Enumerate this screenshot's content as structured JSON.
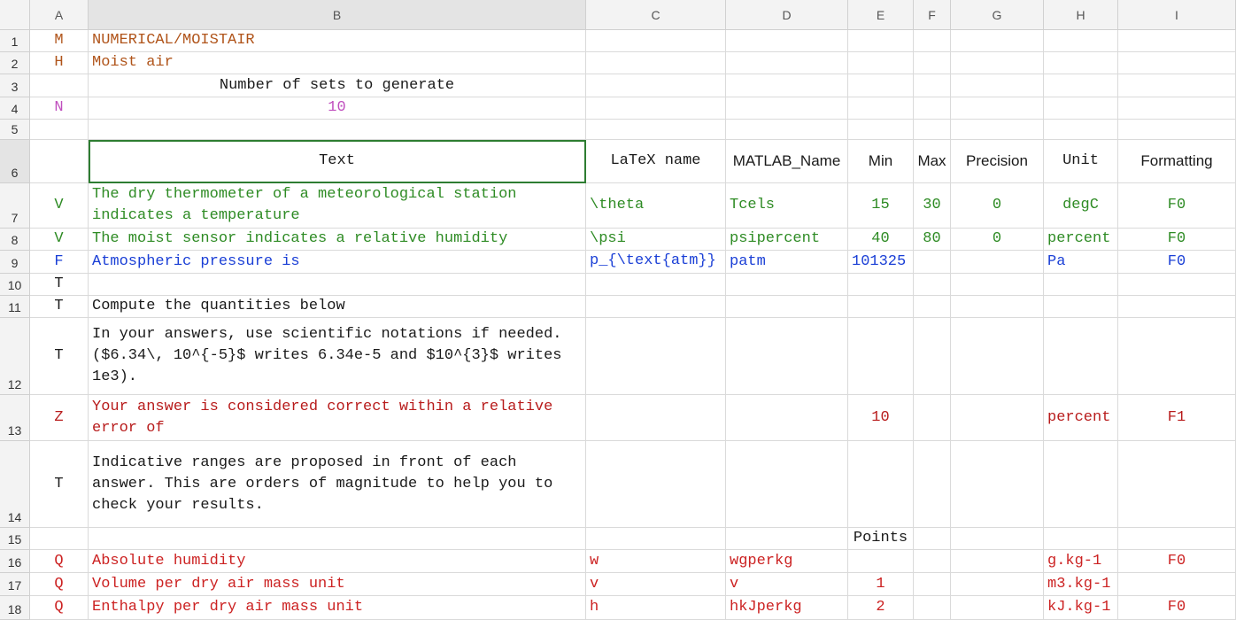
{
  "columns": [
    "A",
    "B",
    "C",
    "D",
    "E",
    "F",
    "G",
    "H",
    "I"
  ],
  "rows": [
    "1",
    "2",
    "3",
    "4",
    "5",
    "6",
    "7",
    "8",
    "9",
    "10",
    "11",
    "12",
    "13",
    "14",
    "15",
    "16",
    "17",
    "18"
  ],
  "colors": {
    "orange": "#b0541a",
    "pink": "#c04fbe",
    "green": "#2e8b24",
    "blue": "#1a3fd6",
    "red": "#cc2222",
    "black": "#1a1a1a"
  },
  "cells": {
    "A1": "M",
    "B1": "NUMERICAL/MOISTAIR",
    "A2": "H",
    "B2": "Moist air",
    "B3": "Number of sets to generate",
    "A4": "N",
    "B4": "10",
    "B6": "Text",
    "C6": "LaTeX name",
    "D6": "MATLAB_Name",
    "E6": "Min",
    "F6": "Max",
    "G6": "Precision",
    "H6": "Unit",
    "I6": "Formatting",
    "A7": "V",
    "B7": "The dry thermometer of a meteorological station indicates a temperature",
    "C7": "\\theta",
    "D7": "Tcels",
    "E7": "15",
    "F7": "30",
    "G7": "0",
    "H7": "degC",
    "I7": "F0",
    "A8": "V",
    "B8": "The moist sensor indicates a relative humidity",
    "C8": "\\psi",
    "D8": "psipercent",
    "E8": "40",
    "F8": "80",
    "G8": "0",
    "H8": "percent",
    "I8": "F0",
    "A9": "F",
    "B9": "Atmospheric pressure is",
    "C9": "p_{\\text{atm}}",
    "D9": "patm",
    "E9": "101325",
    "H9": "Pa",
    "I9": "F0",
    "A10": "T",
    "A11": "T",
    "B11": "Compute the quantities below",
    "A12": "T",
    "B12": "In your answers, use scientific notations if needed.  ($6.34\\, 10^{-5}$ writes 6.34e-5 and $10^{3}$ writes 1e3).",
    "A13": "Z",
    "B13": "Your answer is considered correct within a relative error of",
    "E13": "10",
    "H13": "percent",
    "I13": "F1",
    "A14": "T",
    "B14": "Indicative ranges are proposed in front of each answer. This are orders of magnitude to help you to check your results.",
    "E15": "Points",
    "A16": "Q",
    "B16": "Absolute humidity",
    "C16": "w",
    "D16": "wgperkg",
    "H16": "g.kg-1",
    "I16": "F0",
    "A17": "Q",
    "B17": "Volume per dry air mass unit",
    "C17": "v",
    "D17": "v",
    "E17": "1",
    "H17": "m3.kg-1",
    "A18": "Q",
    "B18": "Enthalpy per dry air mass unit",
    "C18": "h",
    "D18": "hkJperkg",
    "E18": "2",
    "H18": "kJ.kg-1",
    "I18": "F0"
  }
}
